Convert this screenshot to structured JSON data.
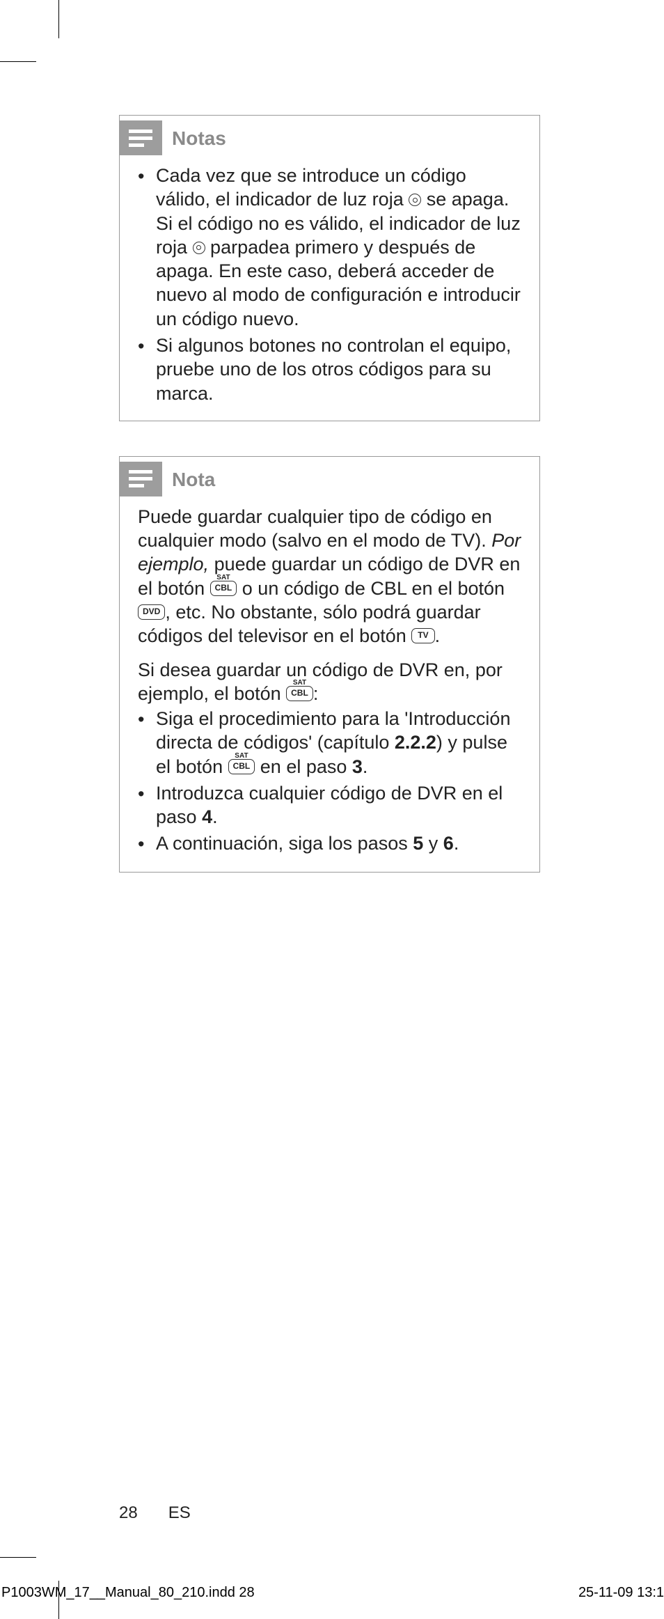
{
  "cropmarks": true,
  "notes_box": {
    "title": "Notas",
    "items": [
      {
        "pre": "Cada vez que se introduce un código válido, el indicador de luz roja ",
        "icon": "record",
        "mid": " se apaga. Si el código no es válido, el indicador de luz roja ",
        "icon2": "record",
        "post": " parpadea primero y después de apaga. En este caso, deberá acceder de nuevo al modo de configuración e introducir un código nuevo."
      },
      {
        "text": "Si algunos botones no controlan el equipo, pruebe uno de los otros códigos para su marca."
      }
    ]
  },
  "nota_box": {
    "title": "Nota",
    "para1_a": "Puede guardar cualquier tipo de código en cualquier modo (salvo en el modo de TV). ",
    "para1_italic": "Por ejemplo,",
    "para1_b": " puede guardar un código de DVR en el botón ",
    "btn_cbl": "CBL",
    "btn_cbl_sup": "SAT",
    "para1_c": " o un código de CBL en el botón ",
    "btn_dvd": "DVD",
    "para1_d": ", etc. No obstante, sólo podrá guardar códigos del televisor en el botón ",
    "btn_tv": "TV",
    "para1_e": ".",
    "para2_a": "Si desea guardar un código de DVR en, por ejemplo, el botón ",
    "para2_b": ":",
    "items": [
      {
        "a": "Siga el procedimiento para la 'Introducción directa de códigos' (capítulo ",
        "bold1": "2.2.2",
        "b": ") y pulse el botón ",
        "btn": "CBL",
        "btn_sup": "SAT",
        "c": " en el paso ",
        "bold2": "3",
        "d": "."
      },
      {
        "a": "Introduzca cualquier código de DVR en el paso ",
        "bold1": "4",
        "d": "."
      },
      {
        "a": "A continuación, siga los pasos ",
        "bold1": "5",
        "b": " y ",
        "bold2": "6",
        "d": "."
      }
    ]
  },
  "footer": {
    "page": "28",
    "lang": "ES"
  },
  "slug": {
    "file": "P1003WM_17__Manual_80_210.indd   28",
    "date": "25-11-09   13:1"
  }
}
